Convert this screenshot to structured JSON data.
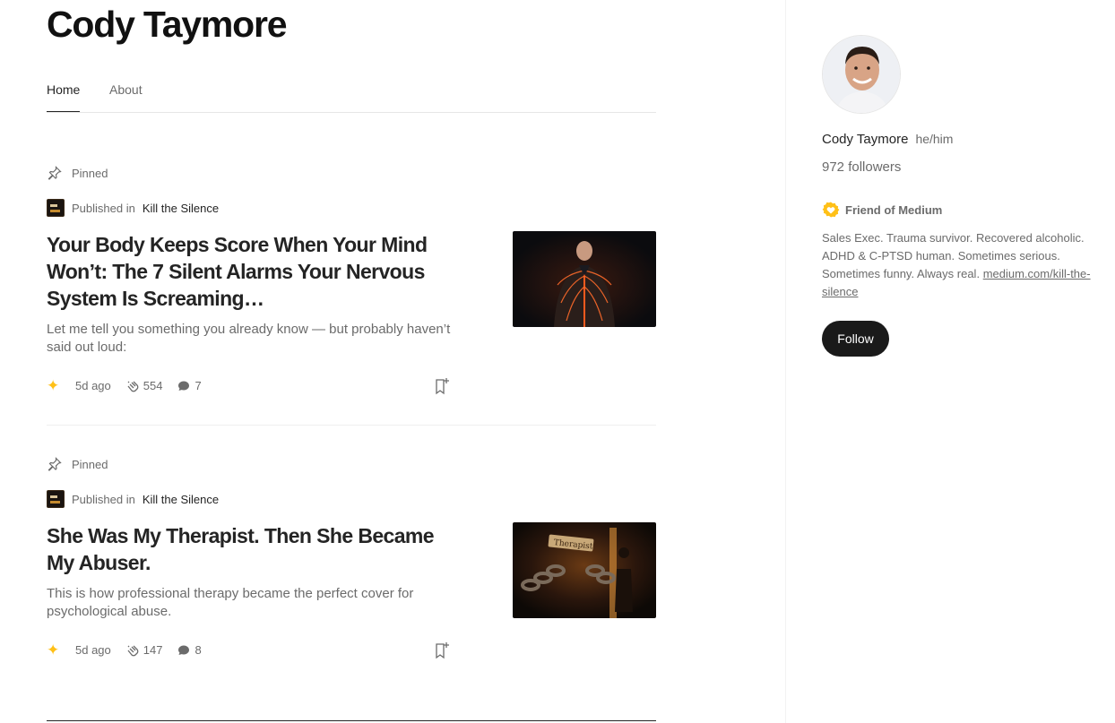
{
  "profile": {
    "title": "Cody Taymore"
  },
  "tabs": [
    {
      "label": "Home",
      "active": true
    },
    {
      "label": "About",
      "active": false
    }
  ],
  "posts": [
    {
      "pinned_label": "Pinned",
      "published_in_label": "Published in",
      "publication": "Kill the Silence",
      "title": "Your Body Keeps Score When Your Mind Won’t: The 7 Silent Alarms Your Nervous System Is Screaming…",
      "subtitle": "Let me tell you something you already know — but probably haven’t said out loud:",
      "date": "5d ago",
      "claps": "554",
      "responses": "7",
      "thumbnail_icon": "nervous-system-illustration"
    },
    {
      "pinned_label": "Pinned",
      "published_in_label": "Published in",
      "publication": "Kill the Silence",
      "title": "She Was My Therapist. Then She Became My Abuser.",
      "subtitle": "This is how professional therapy became the perfect cover for psychological abuse.",
      "date": "5d ago",
      "claps": "147",
      "responses": "8",
      "thumbnail_sign_text": "Therapist",
      "thumbnail_icon": "broken-chains-illustration"
    }
  ],
  "sidebar": {
    "name": "Cody Taymore",
    "pronouns": "he/him",
    "followers": "972 followers",
    "membership": "Friend of Medium",
    "bio": "Sales Exec. Trauma survivor. Recovered alcoholic. ADHD & C-PTSD human. Sometimes serious. Sometimes funny. Always real.",
    "bio_link": "medium.com/kill-the-silence",
    "follow_label": "Follow"
  },
  "colors": {
    "sparkle": "#ffc017",
    "follow_button": "#1a1a1a",
    "text_primary": "#242424",
    "text_secondary": "#6b6b6b"
  }
}
